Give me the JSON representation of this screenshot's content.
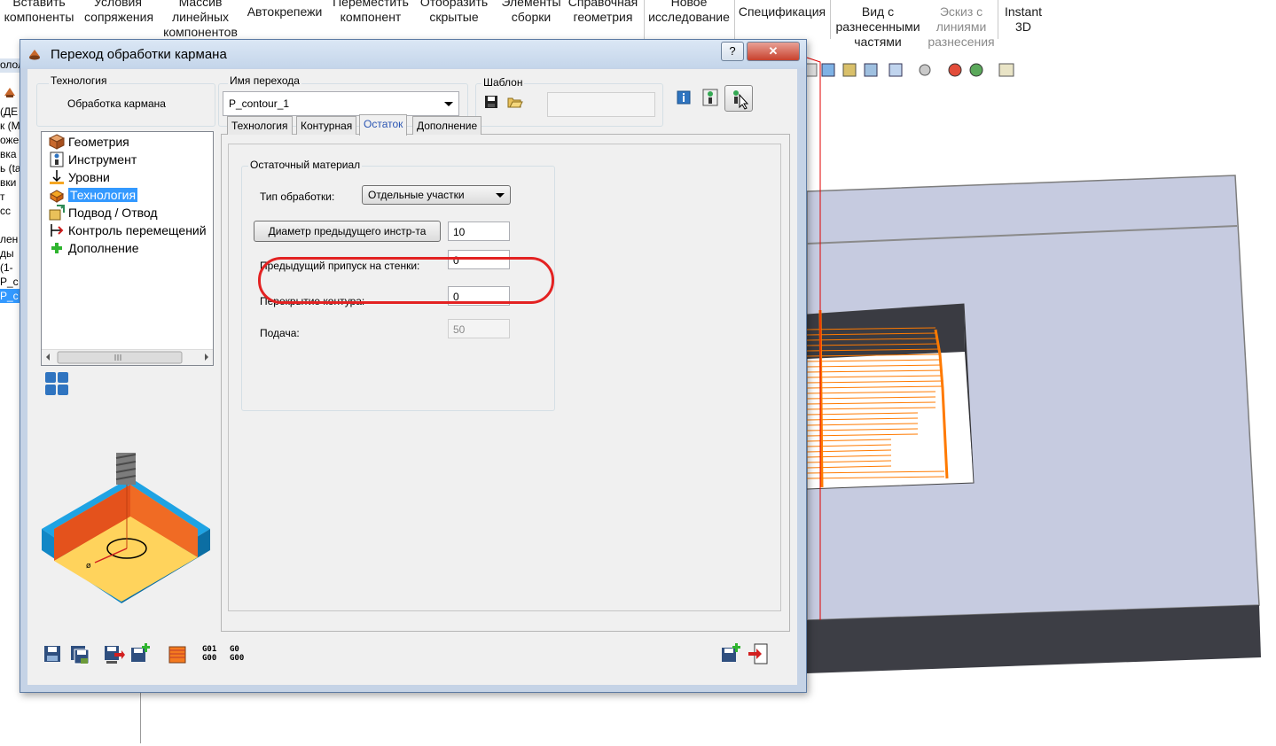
{
  "toolbar": {
    "items": [
      {
        "label": "Вставить\nкомпоненты"
      },
      {
        "label": "Условия\nсопряжения"
      },
      {
        "label": "Массив\nлинейных\nкомпонентов"
      },
      {
        "label": "Автокрепежи"
      },
      {
        "label": "Переместить\nкомпонент"
      },
      {
        "label": "Отобразить\nскрытые"
      },
      {
        "label": "Элементы\nсборки"
      },
      {
        "label": "Справочная\nгеометрия"
      },
      {
        "label": "Новое\nисследование"
      },
      {
        "label": "Спецификация"
      },
      {
        "label": "Вид с\nразнесенными\nчастями"
      },
      {
        "label": "Эскиз с\nлиниями\nразнесения"
      },
      {
        "label": "Instant\n3D"
      }
    ]
  },
  "left_tree": [
    "(ДЕ",
    "к (М",
    "ожер",
    "вка",
    "ь (ta",
    "вки",
    "т",
    "сс",
    "",
    "лен",
    "ды",
    "(1-",
    "P_c",
    "P_c"
  ],
  "left_tab_partial": "олол",
  "dialog": {
    "title": "Переход обработки кармана",
    "help_btn": "?",
    "close_btn": "✕",
    "technology_group": {
      "label": "Технология",
      "value": "Обработка кармана"
    },
    "name_group": {
      "label": "Имя перехода",
      "value": "P_contour_1"
    },
    "template_group": {
      "label": "Шаблон"
    },
    "tree": {
      "items": [
        {
          "label": "Геометрия",
          "icon": "geometry-icon"
        },
        {
          "label": "Инструмент",
          "icon": "tool-icon"
        },
        {
          "label": "Уровни",
          "icon": "levels-icon"
        },
        {
          "label": "Технология",
          "icon": "technology-icon",
          "selected": true
        },
        {
          "label": "Подвод / Отвод",
          "icon": "approach-icon"
        },
        {
          "label": "Контроль перемещений",
          "icon": "motion-control-icon"
        },
        {
          "label": "Дополнение",
          "icon": "plus-icon"
        }
      ]
    },
    "tabs": [
      {
        "label": "Технология"
      },
      {
        "label": "Контурная"
      },
      {
        "label": "Остаток",
        "active": true
      },
      {
        "label": "Дополнение"
      }
    ],
    "remaining": {
      "group_label": "Остаточный материал",
      "type_label": "Тип обработки:",
      "type_value": "Отдельные участки",
      "prev_diam_button": "Диаметр предыдущего инстр-та",
      "prev_diam_value": "10",
      "prev_wall_label": "Предыдущий припуск на стенки:",
      "prev_wall_value": "0",
      "overlap_label": "Перекрытие контура:",
      "overlap_value": "0",
      "feed_label": "Подача:",
      "feed_value": "50"
    },
    "bottom_text_icons": {
      "g01": "G01",
      "g00a": "G00",
      "g0": "G0",
      "g00b": "G00"
    }
  },
  "colors": {
    "accent": "#3399ff",
    "highlight_ring": "#e32222",
    "toolpath": "#ff7a00",
    "model_face": "#c6cbe0"
  }
}
